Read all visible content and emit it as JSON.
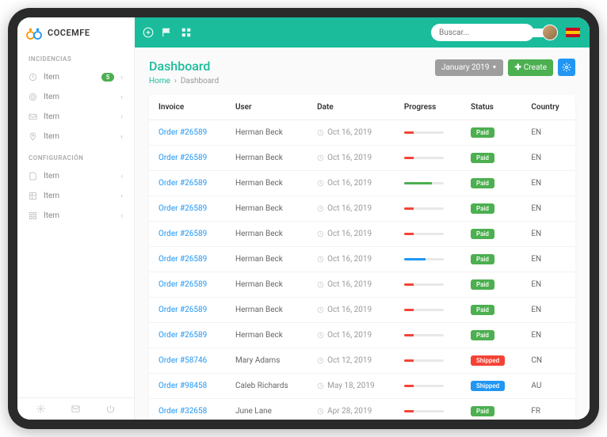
{
  "brand": "COCEMFE",
  "search_placeholder": "Buscar...",
  "sidebar": {
    "sections": [
      {
        "title": "INCIDENCIAS",
        "items": [
          {
            "icon": "clock",
            "label": "Item",
            "badge": "5",
            "expandable": true
          },
          {
            "icon": "target",
            "label": "Item",
            "expandable": true
          },
          {
            "icon": "mail",
            "label": "Item",
            "expandable": true
          },
          {
            "icon": "pin",
            "label": "Item",
            "expandable": true
          }
        ]
      },
      {
        "title": "CONFIGURACIÓN",
        "items": [
          {
            "icon": "doc",
            "label": "Item",
            "expandable": true
          },
          {
            "icon": "table",
            "label": "Item",
            "expandable": true
          },
          {
            "icon": "grid",
            "label": "Item",
            "expandable": true
          }
        ]
      }
    ]
  },
  "page": {
    "title": "Dashboard",
    "breadcrumb": {
      "home": "Home",
      "current": "Dashboard"
    },
    "date_filter": "January 2019",
    "create_label": "Create"
  },
  "table": {
    "headers": [
      "Invoice",
      "User",
      "Date",
      "Progress",
      "Status",
      "Country"
    ],
    "rows": [
      {
        "invoice": "Order #26589",
        "user": "Herman Beck",
        "date": "Oct 16, 2019",
        "progress": 25,
        "color": "#f44336",
        "status": "Paid",
        "status_color": "#4caf50",
        "country": "EN"
      },
      {
        "invoice": "Order #26589",
        "user": "Herman Beck",
        "date": "Oct 16, 2019",
        "progress": 25,
        "color": "#f44336",
        "status": "Paid",
        "status_color": "#4caf50",
        "country": "EN"
      },
      {
        "invoice": "Order #26589",
        "user": "Herman Beck",
        "date": "Oct 16, 2019",
        "progress": 70,
        "color": "#4caf50",
        "status": "Paid",
        "status_color": "#4caf50",
        "country": "EN"
      },
      {
        "invoice": "Order #26589",
        "user": "Herman Beck",
        "date": "Oct 16, 2019",
        "progress": 25,
        "color": "#f44336",
        "status": "Paid",
        "status_color": "#4caf50",
        "country": "EN"
      },
      {
        "invoice": "Order #26589",
        "user": "Herman Beck",
        "date": "Oct 16, 2019",
        "progress": 25,
        "color": "#f44336",
        "status": "Paid",
        "status_color": "#4caf50",
        "country": "EN"
      },
      {
        "invoice": "Order #26589",
        "user": "Herman Beck",
        "date": "Oct 16, 2019",
        "progress": 55,
        "color": "#2196f3",
        "status": "Paid",
        "status_color": "#4caf50",
        "country": "EN"
      },
      {
        "invoice": "Order #26589",
        "user": "Herman Beck",
        "date": "Oct 16, 2019",
        "progress": 25,
        "color": "#f44336",
        "status": "Paid",
        "status_color": "#4caf50",
        "country": "EN"
      },
      {
        "invoice": "Order #26589",
        "user": "Herman Beck",
        "date": "Oct 16, 2019",
        "progress": 25,
        "color": "#f44336",
        "status": "Paid",
        "status_color": "#4caf50",
        "country": "EN"
      },
      {
        "invoice": "Order #26589",
        "user": "Herman Beck",
        "date": "Oct 16, 2019",
        "progress": 25,
        "color": "#f44336",
        "status": "Paid",
        "status_color": "#4caf50",
        "country": "EN"
      },
      {
        "invoice": "Order #58746",
        "user": "Mary Adams",
        "date": "Oct 12, 2019",
        "progress": 25,
        "color": "#f44336",
        "status": "Shipped",
        "status_color": "#f44336",
        "country": "CN"
      },
      {
        "invoice": "Order #98458",
        "user": "Caleb Richards",
        "date": "May 18, 2019",
        "progress": 25,
        "color": "#f44336",
        "status": "Shipped",
        "status_color": "#2196f3",
        "country": "AU"
      },
      {
        "invoice": "Order #32658",
        "user": "June Lane",
        "date": "Apr 28, 2019",
        "progress": 25,
        "color": "#f44336",
        "status": "Paid",
        "status_color": "#4caf50",
        "country": "FR"
      }
    ]
  }
}
